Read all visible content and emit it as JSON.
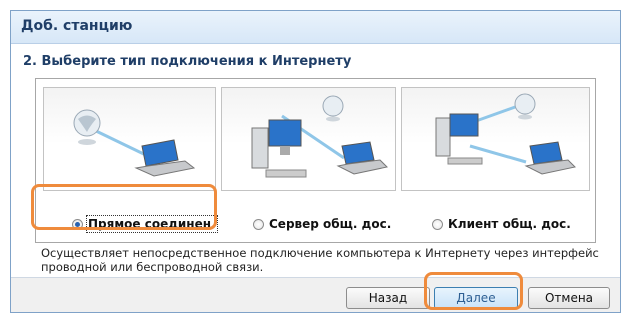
{
  "window": {
    "title": "Доб. станцию"
  },
  "step": {
    "title": "2. Выберите тип подключения к Интернету"
  },
  "options": [
    {
      "label": "Прямое соединен.",
      "selected": true,
      "icon": "globe-laptop-illustration"
    },
    {
      "label": "Сервер общ. дос.",
      "selected": false,
      "icon": "globe-desktop-laptop-illustration"
    },
    {
      "label": "Клиент общ. дос.",
      "selected": false,
      "icon": "globe-desktop-laptop-illustration"
    }
  ],
  "description": "Осуществляет непосредственное подключение компьютера к Интернету через интерфейс проводной или беспроводной связи.",
  "buttons": {
    "back": "Назад",
    "next": "Далее",
    "cancel": "Отмена"
  },
  "colors": {
    "accent": "#1f3e67",
    "highlight": "#ef8b3c",
    "radio_selected": "#2a63b0"
  }
}
